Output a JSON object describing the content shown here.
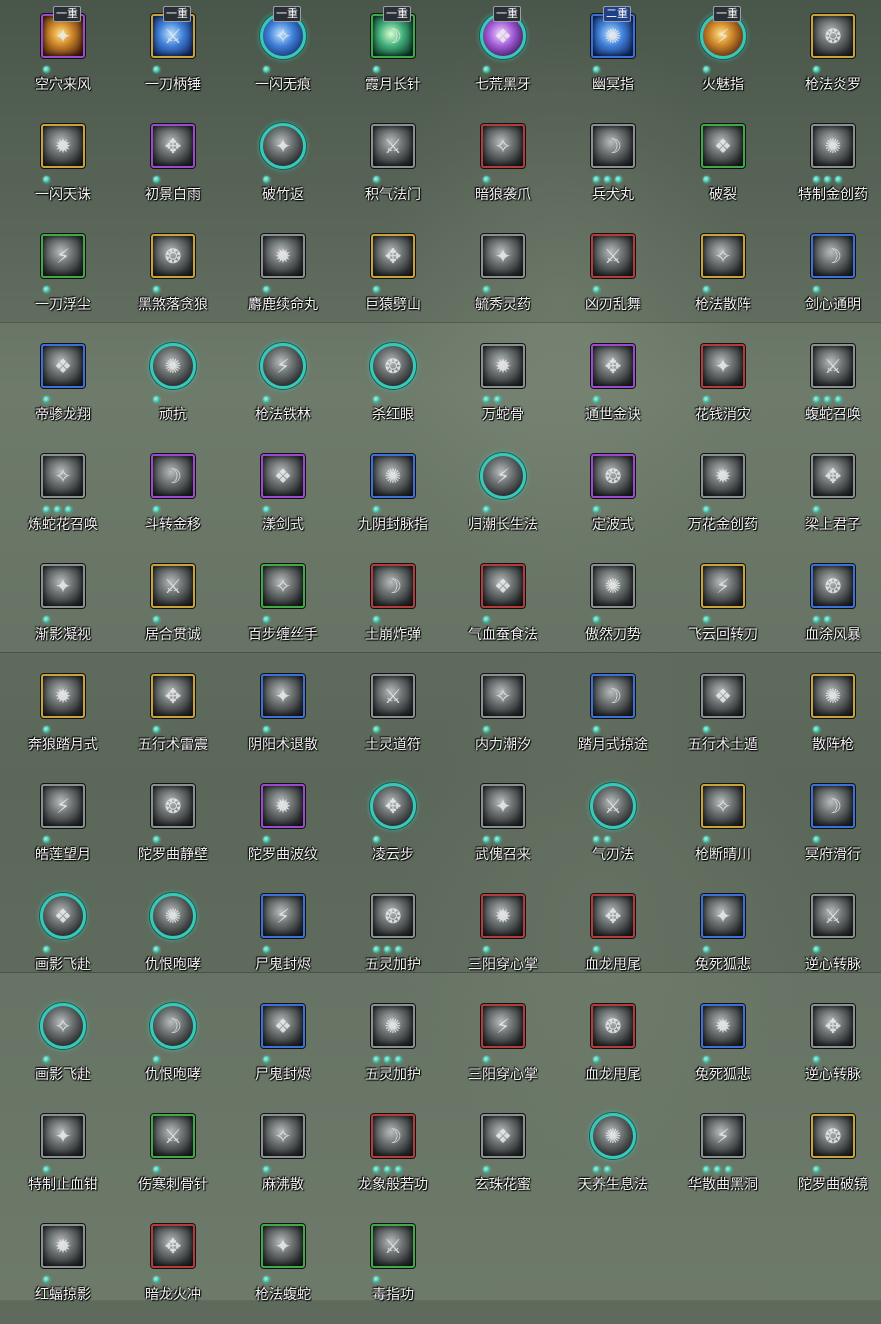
{
  "colors": {
    "frame_gold": "#c9a23a",
    "frame_purple": "#9b49d0",
    "frame_blue": "#3c6fd8",
    "frame_green": "#3fa847",
    "frame_red": "#b33b3b",
    "frame_gray": "#8a8f92",
    "frame_circle_teal": "#38c8b8",
    "pip_teal": "#39b79f",
    "label_text": "#f2f2f2"
  },
  "rows": [
    [
      {
        "name": "空穴来风",
        "frame": "purple",
        "badge": "一重",
        "dots": 1,
        "style": "color"
      },
      {
        "name": "一刀柄锤",
        "frame": "gold",
        "badge": "一重",
        "dots": 1,
        "style": "color",
        "tint": "cblue"
      },
      {
        "name": "一闪无痕",
        "frame": "circle",
        "badge": "一重",
        "dots": 1,
        "style": "color",
        "tint": "cblue"
      },
      {
        "name": "霞月长针",
        "frame": "green",
        "badge": "一重",
        "dots": 1,
        "style": "color",
        "tint": "cgreen"
      },
      {
        "name": "七荒黑牙",
        "frame": "circle",
        "badge": "一重",
        "dots": 1,
        "style": "color",
        "tint": "cpurple"
      },
      {
        "name": "幽冥指",
        "frame": "blue",
        "badge": "二重",
        "badge_style": "blue",
        "dots": 1,
        "style": "color",
        "tint": "cblue"
      },
      {
        "name": "火魅指",
        "frame": "circle",
        "badge": "一重",
        "dots": 1,
        "style": "color"
      },
      {
        "name": "枪法炎罗",
        "frame": "gold",
        "dots": 1
      }
    ],
    [
      {
        "name": "一闪天诛",
        "frame": "gold",
        "dots": 1
      },
      {
        "name": "初景白雨",
        "frame": "purple",
        "dots": 1
      },
      {
        "name": "破竹返",
        "frame": "circle",
        "dots": 1
      },
      {
        "name": "积气法门",
        "frame": "gray",
        "dots": 1
      },
      {
        "name": "暗狼袭爪",
        "frame": "red",
        "dots": 1
      },
      {
        "name": "兵犬丸",
        "frame": "gray",
        "dots": 3
      },
      {
        "name": "破裂",
        "frame": "green",
        "dots": 1
      },
      {
        "name": "特制金创药",
        "frame": "gray",
        "dots": 3
      }
    ],
    [
      {
        "name": "一刀浮尘",
        "frame": "green",
        "dots": 1
      },
      {
        "name": "黑煞落贪狼",
        "frame": "gold",
        "dots": 1
      },
      {
        "name": "麝鹿续命丸",
        "frame": "gray",
        "dots": 1
      },
      {
        "name": "巨猿劈山",
        "frame": "gold",
        "dots": 1
      },
      {
        "name": "毓秀灵药",
        "frame": "gray",
        "dots": 1
      },
      {
        "name": "凶刃乱舞",
        "frame": "red",
        "dots": 1
      },
      {
        "name": "枪法散阵",
        "frame": "gold",
        "dots": 1
      },
      {
        "name": "剑心通明",
        "frame": "blue",
        "dots": 1
      }
    ],
    [
      {
        "name": "帝骖龙翔",
        "frame": "blue",
        "dots": 1
      },
      {
        "name": "顽抗",
        "frame": "circle",
        "dots": 1
      },
      {
        "name": "枪法铁林",
        "frame": "circle",
        "dots": 1
      },
      {
        "name": "杀红眼",
        "frame": "circle",
        "dots": 1
      },
      {
        "name": "万蛇骨",
        "frame": "gray",
        "dots": 2
      },
      {
        "name": "通世金诀",
        "frame": "purple",
        "dots": 1
      },
      {
        "name": "花钱消灾",
        "frame": "red",
        "dots": 1
      },
      {
        "name": "蝮蛇召唤",
        "frame": "gray",
        "dots": 3
      }
    ],
    [
      {
        "name": "炼蛇花召唤",
        "frame": "gray",
        "dots": 3
      },
      {
        "name": "斗转金移",
        "frame": "purple",
        "dots": 1
      },
      {
        "name": "漾剑式",
        "frame": "purple",
        "dots": 1
      },
      {
        "name": "九阴封脉指",
        "frame": "blue",
        "dots": 1
      },
      {
        "name": "归潮长生法",
        "frame": "circle",
        "dots": 1
      },
      {
        "name": "定波式",
        "frame": "purple",
        "dots": 1
      },
      {
        "name": "万花金创药",
        "frame": "gray",
        "dots": 1
      },
      {
        "name": "梁上君子",
        "frame": "gray",
        "dots": 1
      }
    ],
    [
      {
        "name": "渐影凝视",
        "frame": "gray",
        "dots": 1
      },
      {
        "name": "居合贯诚",
        "frame": "gold",
        "dots": 1
      },
      {
        "name": "百步缠丝手",
        "frame": "green",
        "dots": 1
      },
      {
        "name": "土崩炸弹",
        "frame": "red",
        "dots": 1
      },
      {
        "name": "气血蚕食法",
        "frame": "red",
        "dots": 1
      },
      {
        "name": "傲然刀势",
        "frame": "gray",
        "dots": 1
      },
      {
        "name": "飞云回转刀",
        "frame": "gold",
        "dots": 1
      },
      {
        "name": "血涂风暴",
        "frame": "blue",
        "dots": 2
      }
    ],
    [
      {
        "name": "奔狼踏月式",
        "frame": "gold",
        "dots": 1
      },
      {
        "name": "五行术雷震",
        "frame": "gold",
        "dots": 1
      },
      {
        "name": "阴阳术退散",
        "frame": "blue",
        "dots": 1
      },
      {
        "name": "土灵道符",
        "frame": "gray",
        "dots": 1
      },
      {
        "name": "内力潮汐",
        "frame": "gray",
        "dots": 1
      },
      {
        "name": "踏月式掠途",
        "frame": "blue",
        "dots": 1
      },
      {
        "name": "五行术土遁",
        "frame": "gray",
        "dots": 1
      },
      {
        "name": "散阵枪",
        "frame": "gold",
        "dots": 1
      }
    ],
    [
      {
        "name": "皓莲望月",
        "frame": "gray",
        "dots": 1
      },
      {
        "name": "陀罗曲静壁",
        "frame": "gray",
        "dots": 1
      },
      {
        "name": "陀罗曲波纹",
        "frame": "purple",
        "dots": 1
      },
      {
        "name": "凌云步",
        "frame": "circle",
        "dots": 1
      },
      {
        "name": "武傀召来",
        "frame": "gray",
        "dots": 2
      },
      {
        "name": "气刃法",
        "frame": "circle",
        "dots": 2
      },
      {
        "name": "枪断晴川",
        "frame": "gold",
        "dots": 1
      },
      {
        "name": "冥府滑行",
        "frame": "blue",
        "dots": 1
      }
    ],
    [
      {
        "name": "画影飞赴",
        "frame": "circle",
        "dots": 1
      },
      {
        "name": "仇恨咆哮",
        "frame": "circle",
        "dots": 1
      },
      {
        "name": "尸鬼封烬",
        "frame": "blue",
        "dots": 1
      },
      {
        "name": "五灵加护",
        "frame": "gray",
        "dots": 3
      },
      {
        "name": "三阳穿心掌",
        "frame": "red",
        "dots": 1
      },
      {
        "name": "血龙甩尾",
        "frame": "red",
        "dots": 1
      },
      {
        "name": "兔死狐悲",
        "frame": "blue",
        "dots": 1
      },
      {
        "name": "逆心转脉",
        "frame": "gray",
        "dots": 1
      }
    ],
    [
      {
        "name": "画影飞赴",
        "frame": "circle",
        "dots": 1
      },
      {
        "name": "仇恨咆哮",
        "frame": "circle",
        "dots": 1
      },
      {
        "name": "尸鬼封烬",
        "frame": "blue",
        "dots": 1
      },
      {
        "name": "五灵加护",
        "frame": "gray",
        "dots": 3
      },
      {
        "name": "三阳穿心掌",
        "frame": "red",
        "dots": 1
      },
      {
        "name": "血龙甩尾",
        "frame": "red",
        "dots": 1
      },
      {
        "name": "兔死狐悲",
        "frame": "blue",
        "dots": 1
      },
      {
        "name": "逆心转脉",
        "frame": "gray",
        "dots": 1
      }
    ],
    [
      {
        "name": "特制止血钳",
        "frame": "gray",
        "dots": 1
      },
      {
        "name": "伤寒刺骨针",
        "frame": "green",
        "dots": 1
      },
      {
        "name": "麻沸散",
        "frame": "gray",
        "dots": 1
      },
      {
        "name": "龙象般若功",
        "frame": "red",
        "dots": 3
      },
      {
        "name": "玄珠花蜜",
        "frame": "gray",
        "dots": 1
      },
      {
        "name": "天养生息法",
        "frame": "circle",
        "dots": 2
      },
      {
        "name": "华散曲黑洞",
        "frame": "gray",
        "dots": 3
      },
      {
        "name": "陀罗曲破镜",
        "frame": "gold",
        "dots": 1
      }
    ],
    [
      {
        "name": "红蝠掠影",
        "frame": "gray",
        "dots": 1
      },
      {
        "name": "暗龙火冲",
        "frame": "red",
        "dots": 1
      },
      {
        "name": "枪法蝮蛇",
        "frame": "green",
        "dots": 1
      },
      {
        "name": "毒指功",
        "frame": "green",
        "dots": 1
      }
    ]
  ]
}
